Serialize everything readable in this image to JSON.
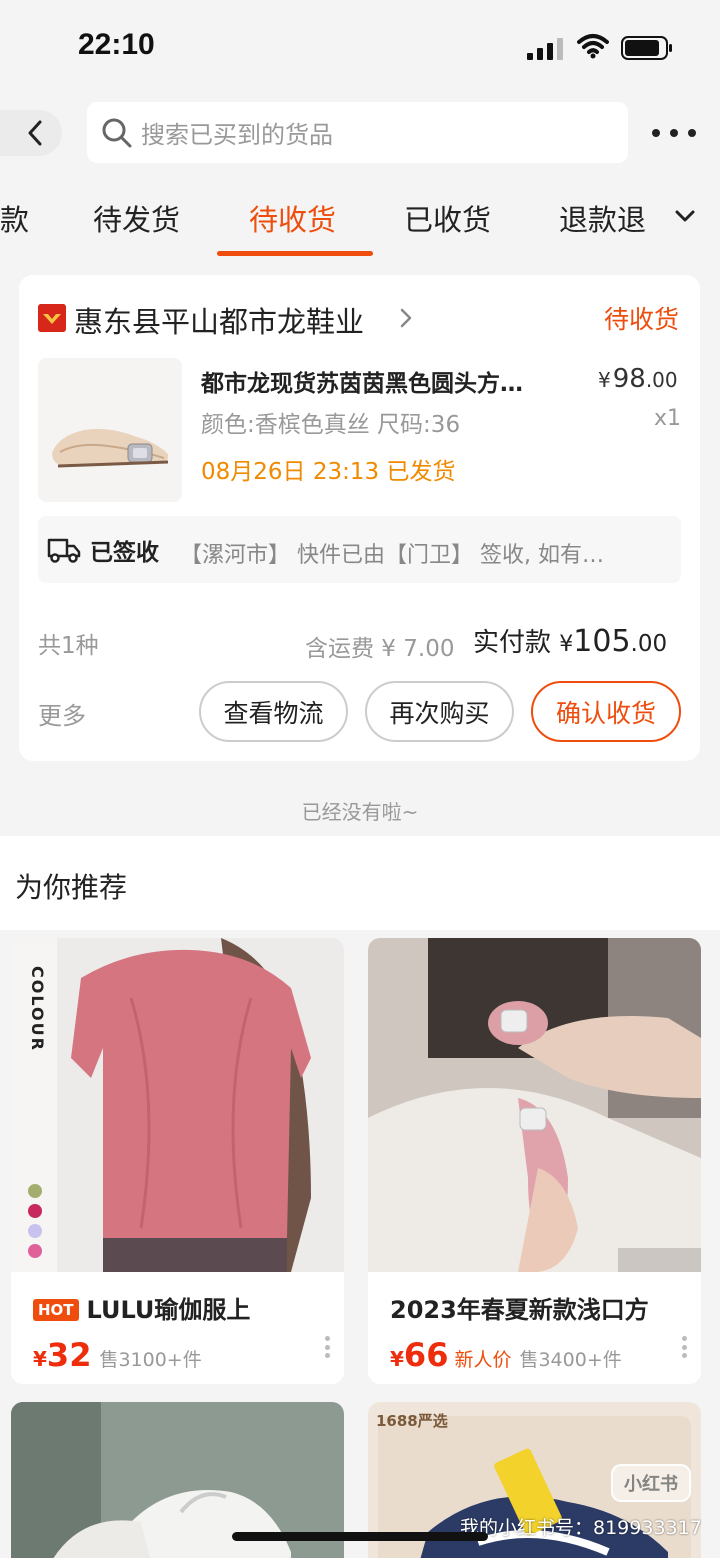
{
  "status_bar": {
    "time": "22:10"
  },
  "search": {
    "placeholder": "搜索已买到的货品"
  },
  "tabs": [
    {
      "label": "款"
    },
    {
      "label": "待发货"
    },
    {
      "label": "待收货"
    },
    {
      "label": "已收货"
    },
    {
      "label": "退款退"
    }
  ],
  "active_tab": "待收货",
  "order": {
    "shop_name": "惠东县平山都市龙鞋业",
    "status": "待收货",
    "product": {
      "title": "都市龙现货苏茵茵黑色圆头方…",
      "spec": "颜色:香槟色真丝 尺码:36",
      "ship_info": "08月26日 23:13 已发货",
      "price_yen": "¥",
      "price_int": "98",
      "price_dec": ".00",
      "qty": "x1"
    },
    "logistics": {
      "status": "已签收",
      "message": "【漯河市】 快件已由【门卫】 签收, 如有…"
    },
    "summary": {
      "count": "共1种",
      "freight": "含运费 ¥ 7.00",
      "paid_label": "实付款",
      "paid_yen": "¥",
      "paid_int": "105",
      "paid_dec": ".00"
    },
    "actions": {
      "more": "更多",
      "logistics": "查看物流",
      "rebuy": "再次购买",
      "confirm": "确认收货"
    }
  },
  "end_hint": "已经没有啦~",
  "recommend": {
    "title": "为你推荐",
    "items": [
      {
        "badge": "HOT",
        "title": "LULU瑜伽服上",
        "yen": "¥",
        "price": "32",
        "tag": "",
        "sold": "售3100+件",
        "image_text": "COLOUR"
      },
      {
        "badge": "",
        "title": "2023年春夏新款浅口方",
        "yen": "¥",
        "price": "66",
        "tag": "新人价",
        "sold": "售3400+件",
        "image_text": ""
      },
      {
        "image_text": ""
      },
      {
        "image_text": "1688严选"
      }
    ]
  },
  "watermark": {
    "logo": "小红书",
    "id": "我的小红书号：819933317"
  },
  "colors": {
    "accent": "#ee4d0d",
    "shipping": "#f08a00",
    "price": "#ee2d0d"
  }
}
